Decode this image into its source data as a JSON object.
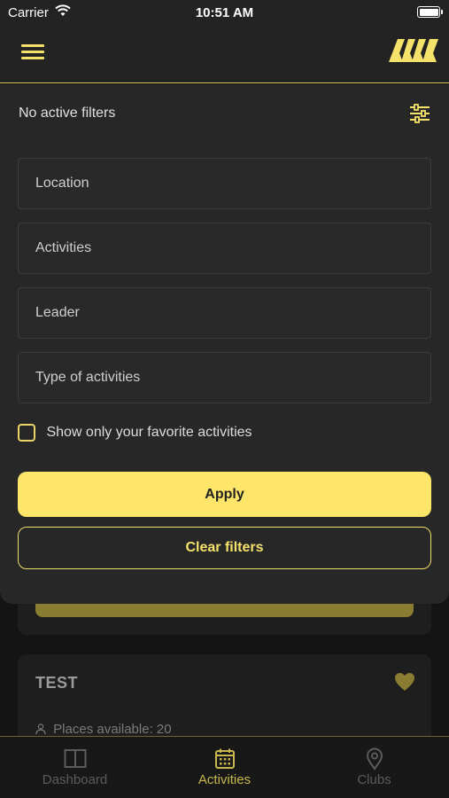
{
  "status_bar": {
    "carrier": "Carrier",
    "time": "10:51 AM"
  },
  "header": {
    "menu_icon": "hamburger-icon",
    "logo_icon": "brand-logo"
  },
  "filters": {
    "status": "No active filters",
    "sliders_icon": "sliders-icon",
    "fields": {
      "location": "Location",
      "activities": "Activities",
      "leader": "Leader",
      "type": "Type of activities"
    },
    "favorites_label": "Show only your favorite activities",
    "favorites_checked": false,
    "apply_label": "Apply",
    "clear_label": "Clear filters"
  },
  "background_card": {
    "title": "TEST",
    "places_text": "Places available: 20",
    "favorite_icon": "heart-icon"
  },
  "tabs": [
    {
      "label": "Dashboard",
      "icon": "dashboard-icon",
      "active": false
    },
    {
      "label": "Activities",
      "icon": "calendar-icon",
      "active": true
    },
    {
      "label": "Clubs",
      "icon": "location-pin-icon",
      "active": false
    }
  ],
  "colors": {
    "accent": "#fde66a",
    "background": "#141414",
    "sheet": "#272727",
    "inactive_tab": "#5c5c5c"
  }
}
